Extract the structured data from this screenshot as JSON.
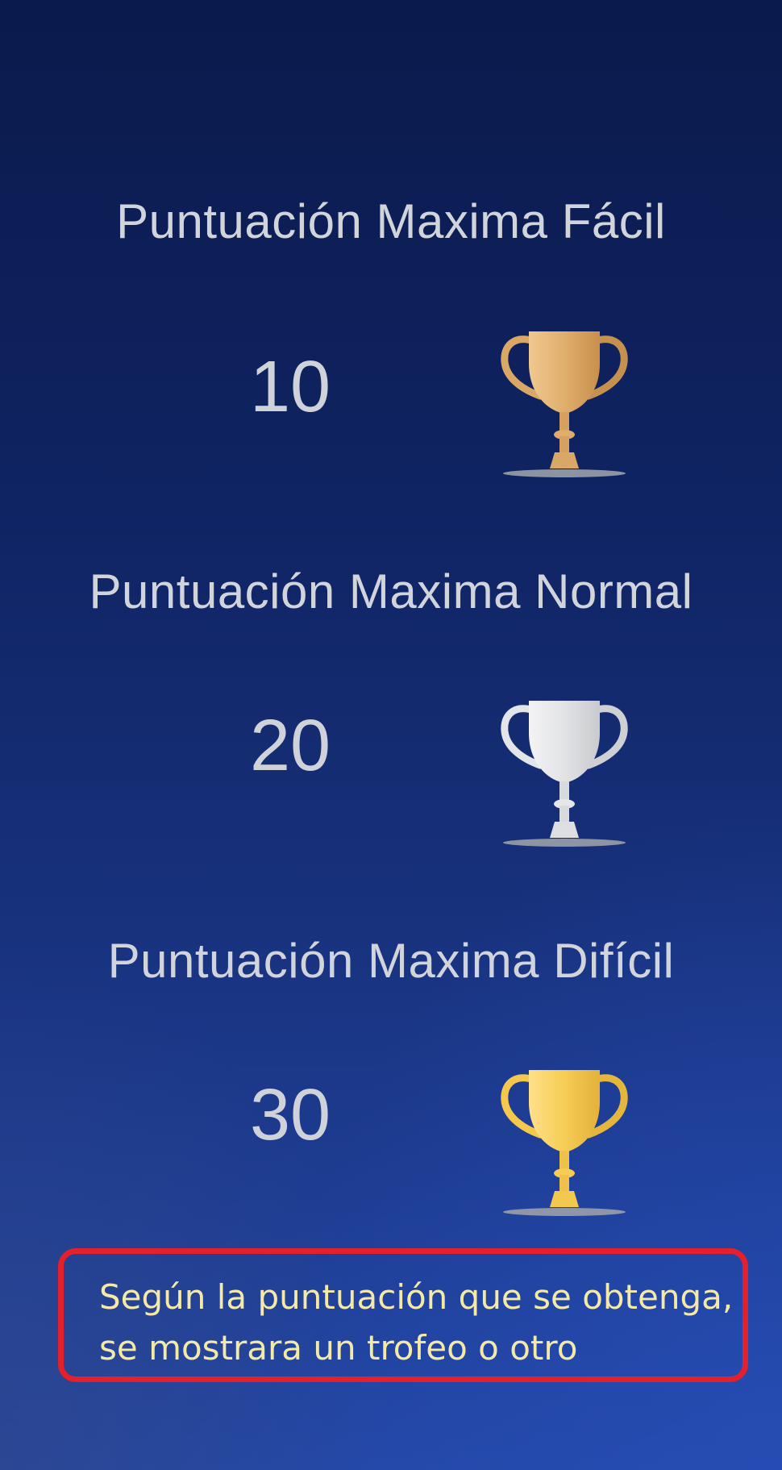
{
  "scores": [
    {
      "title": "Puntuación Maxima Fácil",
      "value": "10",
      "trophy_icon": "bronze-trophy-icon",
      "trophy_color": "#d9a866"
    },
    {
      "title": "Puntuación Maxima Normal",
      "value": "20",
      "trophy_icon": "silver-trophy-icon",
      "trophy_color": "#dedfe2"
    },
    {
      "title": "Puntuación Maxima Difícil",
      "value": "30",
      "trophy_icon": "gold-trophy-icon",
      "trophy_color": "#f2c84f"
    }
  ],
  "note": {
    "line1": "Según la puntuación que se obtenga,",
    "line2": "se mostrara un trofeo o otro",
    "border_color": "#e3202c",
    "text_color": "#f4e9a6"
  }
}
